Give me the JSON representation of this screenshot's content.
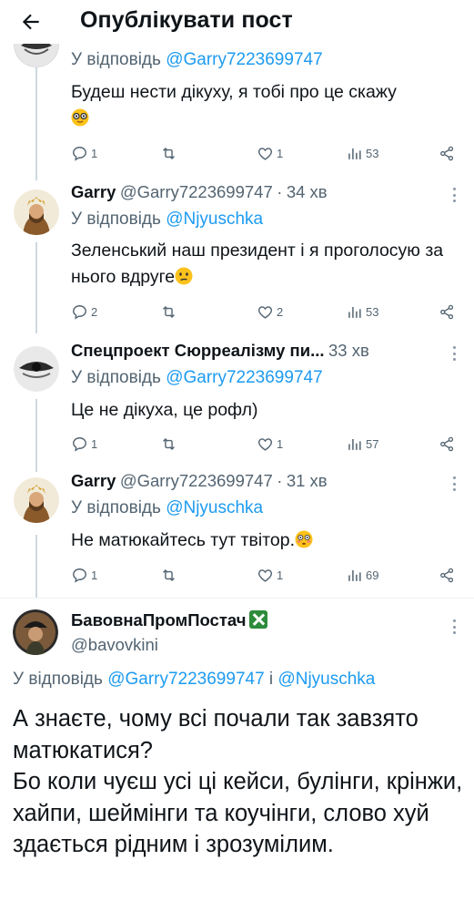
{
  "header": {
    "title": "Опублікувати пост"
  },
  "tweets": [
    {
      "reply_prefix": "У відповідь ",
      "reply_to": "@Garry7223699747",
      "text": "Будеш нести дікуху, я тобі про це скажу",
      "emoji": "nerd-face-emoji",
      "stats": {
        "replies": "1",
        "retweets": "",
        "likes": "1",
        "views": "53"
      }
    },
    {
      "name": "Garry",
      "handle": "@Garry7223699747",
      "sep": "·",
      "time": "34 хв",
      "reply_prefix": "У відповідь ",
      "reply_to": "@Njyuschka",
      "text": "Зеленський наш президент і я проголосую за нього вдруге",
      "emoji": "confused-face-emoji",
      "stats": {
        "replies": "2",
        "retweets": "",
        "likes": "2",
        "views": "53"
      }
    },
    {
      "name": "Спецпроект Сюрреалізму пи...",
      "sep": "",
      "time": "33 хв",
      "reply_prefix": "У відповідь ",
      "reply_to": "@Garry7223699747",
      "text": "Це не дікуха, це рофл)",
      "stats": {
        "replies": "1",
        "retweets": "",
        "likes": "1",
        "views": "57"
      }
    },
    {
      "name": "Garry",
      "handle": "@Garry7223699747",
      "sep": "·",
      "time": "31 хв",
      "reply_prefix": "У відповідь ",
      "reply_to": "@Njyuschka",
      "text": "Не матюкайтесь тут твітор.",
      "emoji": "flushed-face-emoji",
      "stats": {
        "replies": "1",
        "retweets": "",
        "likes": "1",
        "views": "69"
      }
    }
  ],
  "main_post": {
    "name": "БавовнаПромПостач",
    "handle": "@bavovkini",
    "reply_prefix": "У відповідь ",
    "reply_to_1": "@Garry7223699747",
    "reply_and": " і ",
    "reply_to_2": "@Njyuschka",
    "text": "А знаєте, чому всі почали так завзято матюкатися?\nБо коли чуєш усі ці кейси, булінги, крінжи, хайпи, шеймінги та коучінги, слово хуй здається рідним і зрозумілим."
  },
  "colors": {
    "accent": "#1d9bf0",
    "muted": "#536471",
    "text": "#0f1419",
    "verified": "#2e8b3b"
  }
}
